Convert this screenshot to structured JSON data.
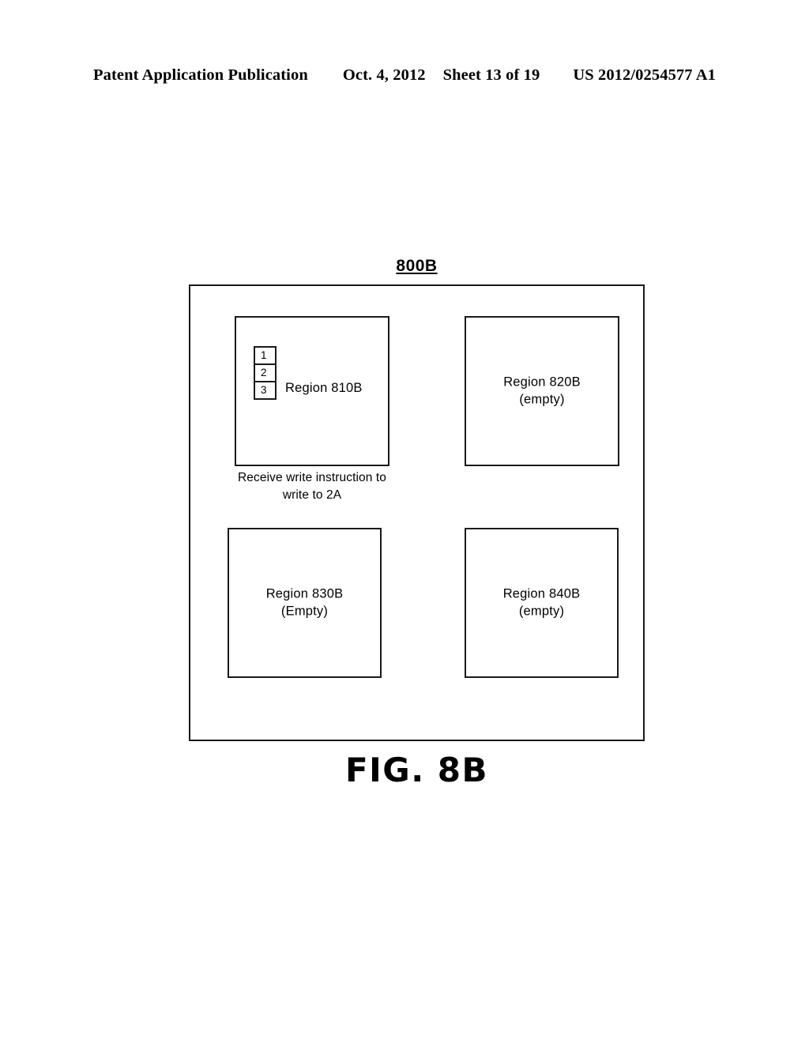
{
  "header": {
    "publication": "Patent Application Publication",
    "date": "Oct. 4, 2012",
    "sheet": "Sheet 13 of 19",
    "document_number": "US 2012/0254577 A1"
  },
  "figure": {
    "reference_label": "800B",
    "caption": "FIG. 8B",
    "regions": [
      {
        "id": "810B",
        "name": "Region 810B",
        "state": "",
        "cells": [
          "1",
          "2",
          "3"
        ],
        "caption": "Receive write instruction to write to 2A"
      },
      {
        "id": "820B",
        "name": "Region 820B",
        "state": "(empty)",
        "cells": [],
        "caption": ""
      },
      {
        "id": "830B",
        "name": "Region 830B",
        "state": "(Empty)",
        "cells": [],
        "caption": ""
      },
      {
        "id": "840B",
        "name": "Region 840B",
        "state": "(empty)",
        "cells": [],
        "caption": ""
      }
    ]
  },
  "colors": {
    "ink": "#1a1a1a",
    "paper": "#ffffff"
  }
}
